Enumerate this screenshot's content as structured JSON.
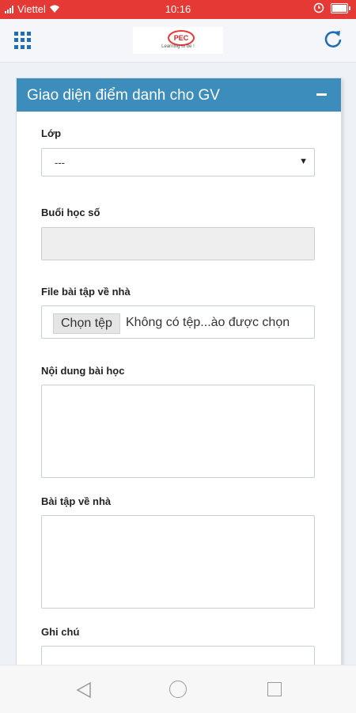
{
  "status_bar": {
    "carrier": "Viettel",
    "time": "10:16",
    "battery_level": 0.9,
    "color": "#e53935"
  },
  "app_bar": {
    "menu_icon": "grid-icon",
    "logo": {
      "text": "PEC",
      "tagline": "Learning to be !"
    },
    "refresh_icon": "refresh-icon"
  },
  "panel": {
    "title": "Giao diện điểm danh cho GV",
    "header_color": "#3c8dbc",
    "collapse_icon": "minus-icon"
  },
  "form": {
    "class_label": "Lớp",
    "class_value": "---",
    "session_label": "Buổi học số",
    "session_value": "",
    "homework_file_label": "File bài tập về nhà",
    "file_button": "Chọn tệp",
    "file_status": "Không có tệp...ào được chọn",
    "lesson_content_label": "Nội dung bài học",
    "homework_label": "Bài tập về nhà",
    "notes_label": "Ghi chú"
  },
  "nav_bar": {
    "back_icon": "back-triangle-icon",
    "home_icon": "home-circle-icon",
    "recent_icon": "recent-square-icon"
  }
}
